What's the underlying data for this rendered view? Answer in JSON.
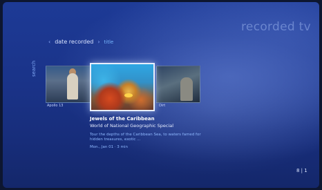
{
  "app_title": "recorded tv",
  "sort": {
    "date": "date recorded",
    "title": "title"
  },
  "side_label": "search",
  "thumbs": [
    {
      "label": "Apollo 13"
    },
    {
      "label": ""
    },
    {
      "label": "Dirt"
    }
  ],
  "details": {
    "title": "Jewels of the Caribbean",
    "subtitle": "World of National Geographic Special",
    "description": "Tour the depths of the Caribbean Sea, to waters famed for hidden treasures, exotic ...",
    "meta": "Mon., Jan 01 · 3 min"
  },
  "page_indicator": "8 | 1"
}
